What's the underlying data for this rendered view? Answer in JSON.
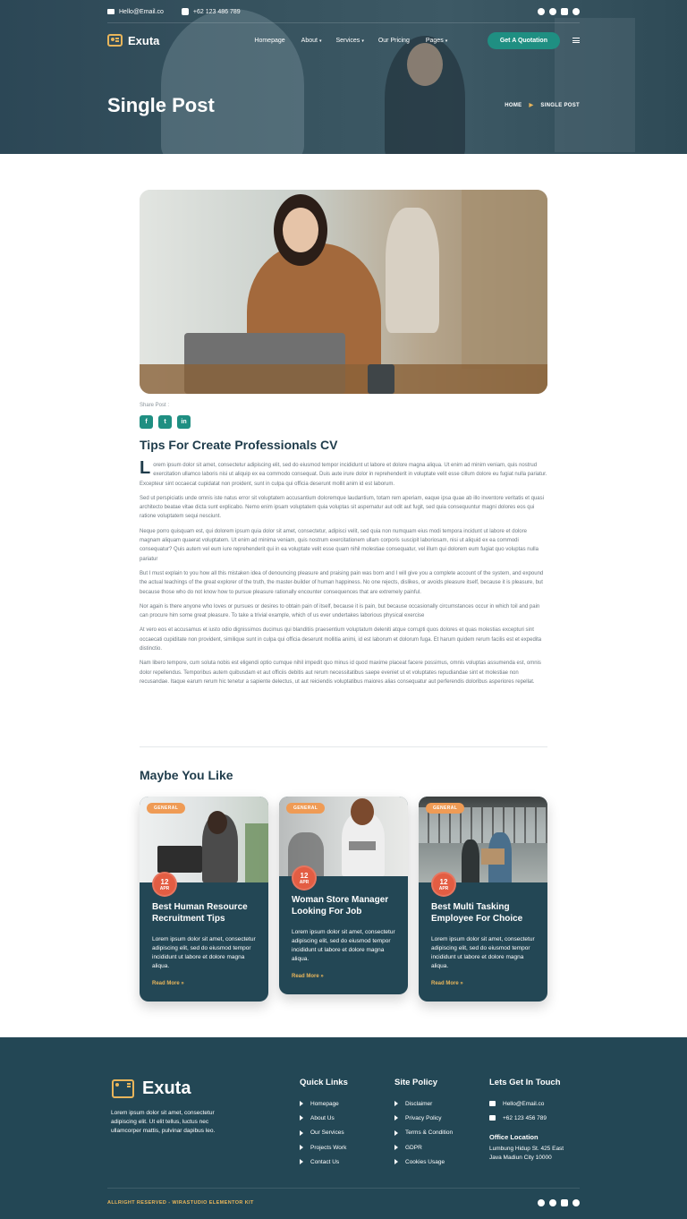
{
  "topbar": {
    "email": "Hello@Email.co",
    "phone": "+62 123 486 789",
    "socials": [
      "facebook-icon",
      "twitter-icon",
      "youtube-icon",
      "pinterest-icon"
    ]
  },
  "nav": {
    "brand": "Exuta",
    "items": [
      {
        "label": "Homepage",
        "caret": ""
      },
      {
        "label": "About",
        "caret": "▾"
      },
      {
        "label": "Services",
        "caret": "▾"
      },
      {
        "label": "Our Pricing",
        "caret": ""
      },
      {
        "label": "Pages",
        "caret": "▾"
      }
    ],
    "cta": "Get A Quotation"
  },
  "hero": {
    "title": "Single Post",
    "crumb_home": "HOME",
    "crumb_sep": "▶",
    "crumb_current": "SINGLE POST"
  },
  "post": {
    "share_label": "Share Post :",
    "share": [
      "f",
      "t",
      "in"
    ],
    "title": "Tips For Create Professionals CV",
    "dropcap": "L",
    "paragraphs": [
      "orem ipsum dolor sit amet, consectetur adipiscing elit, sed do eiusmod tempor incididunt ut labore et dolore magna aliqua. Ut enim ad minim veniam, quis nostrud exercitation ullamco laboris nisi ut aliquip ex ea commodo consequat. Duis aute irure dolor in reprehenderit in voluptate velit esse cillum dolore eu fugiat nulla pariatur. Excepteur sint occaecat cupidatat non proident, sunt in culpa qui officia deserunt mollit anim id est laborum.",
      "Sed ut perspiciatis unde omnis iste natus error sit voluptatem accusantium doloremque laudantium, totam rem aperiam, eaque ipsa quae ab illo inventore veritatis et quasi architecto beatae vitae dicta sunt explicabo. Nemo enim ipsam voluptatem quia voluptas sit aspernatur aut odit aut fugit, sed quia consequuntur magni dolores eos qui ratione voluptatem sequi nesciunt.",
      "Neque porro quisquam est, qui dolorem ipsum quia dolor sit amet, consectetur, adipisci velit, sed quia non numquam eius modi tempora incidunt ut labore et dolore magnam aliquam quaerat voluptatem. Ut enim ad minima veniam, quis nostrum exercitationem ullam corporis suscipit laboriosam, nisi ut aliquid ex ea commodi consequatur? Quis autem vel eum iure reprehenderit qui in ea voluptate velit esse quam nihil molestiae consequatur, vel illum qui dolorem eum fugiat quo voluptas nulla pariatur",
      "But I must explain to you how all this mistaken idea of denouncing pleasure and praising pain was born and I will give you a complete account of the system, and expound the actual teachings of the great explorer of the truth, the master-builder of human happiness. No one rejects, dislikes, or avoids pleasure itself, because it is pleasure, but because those who do not know how to pursue pleasure rationally encounter consequences that are extremely painful.",
      "Nor again is there anyone who loves or pursues or desires to obtain pain of itself, because it is pain, but because occasionally circumstances occur in which toil and pain can procure him some great pleasure. To take a trivial example, which of us ever undertakes laborious physical exercise",
      "At vero eos et accusamus et iusto odio dignissimos ducimus qui blanditiis praesentium voluptatum deleniti atque corrupti quos dolores et quas molestias excepturi sint occaecati cupiditate non provident, similique sunt in culpa qui officia deserunt mollitia animi, id est laborum et dolorum fuga. Et harum quidem rerum facilis est et expedita distinctio.",
      "Nam libero tempore, cum soluta nobis est eligendi optio cumque nihil impedit quo minus id quod maxime placeat facere possimus, omnis voluptas assumenda est, omnis dolor repellendus. Temporibus autem quibusdam et aut officiis debitis aut rerum necessitatibus saepe eveniet ut et voluptates repudiandae sint et molestiae non recusandae. Itaque earum rerum hic tenetur a sapiente delectus, ut aut reiciendis voluptatibus maiores alias consequatur aut perferendis doloribus asperiores repellat."
    ]
  },
  "related": {
    "title": "Maybe You Like",
    "cards": [
      {
        "badge": "GENERAL",
        "day": "12",
        "month": "APR",
        "title": "Best Human Resource Recruitment Tips",
        "excerpt": "Lorem ipsum dolor sit amet, consectetur adipiscing elit, sed do eiusmod tempor incididunt ut labore et dolore magna aliqua.",
        "more": "Read More »"
      },
      {
        "badge": "GENERAL",
        "day": "12",
        "month": "APR",
        "title": "Woman Store Manager Looking For Job",
        "excerpt": "Lorem ipsum dolor sit amet, consectetur adipiscing elit, sed do eiusmod tempor incididunt ut labore et dolore magna aliqua.",
        "more": "Read More »"
      },
      {
        "badge": "GENERAL",
        "day": "12",
        "month": "APR",
        "title": "Best Multi Tasking Employee For Choice",
        "excerpt": "Lorem ipsum dolor sit amet, consectetur adipiscing elit, sed do eiusmod tempor incididunt ut labore et dolore magna aliqua.",
        "more": "Read More »"
      }
    ]
  },
  "footer": {
    "brand": "Exuta",
    "about": "Lorem ipsum dolor sit amet, consectetur adipiscing elit. Ut elit tellus, luctus nec ullamcorper mattis, pulvinar dapibus leo.",
    "quick_links_title": "Quick Links",
    "quick_links": [
      "Homepage",
      "About Us",
      "Our Services",
      "Projects Work",
      "Contact Us"
    ],
    "policy_title": "Site Policy",
    "policy": [
      "Disclaimer",
      "Privacy Policy",
      "Terms & Condition",
      "GDPR",
      "Cookies Usage"
    ],
    "contact_title": "Lets Get In Touch",
    "email": "Hello@Email.co",
    "phone": "+62 123 456 789",
    "office_title": "Office Location",
    "office_address": "Lumbung Hidup St. 425 East Java Madiun City 10000",
    "copyright": "ALLRIGHT RESERVED - WIRASTUDIO ELEMENTOR KIT"
  },
  "colors": {
    "dark": "#234755",
    "teal": "#1f8f82",
    "gold": "#e8b55b",
    "orange": "#ef9b55",
    "date": "#e35d43"
  }
}
